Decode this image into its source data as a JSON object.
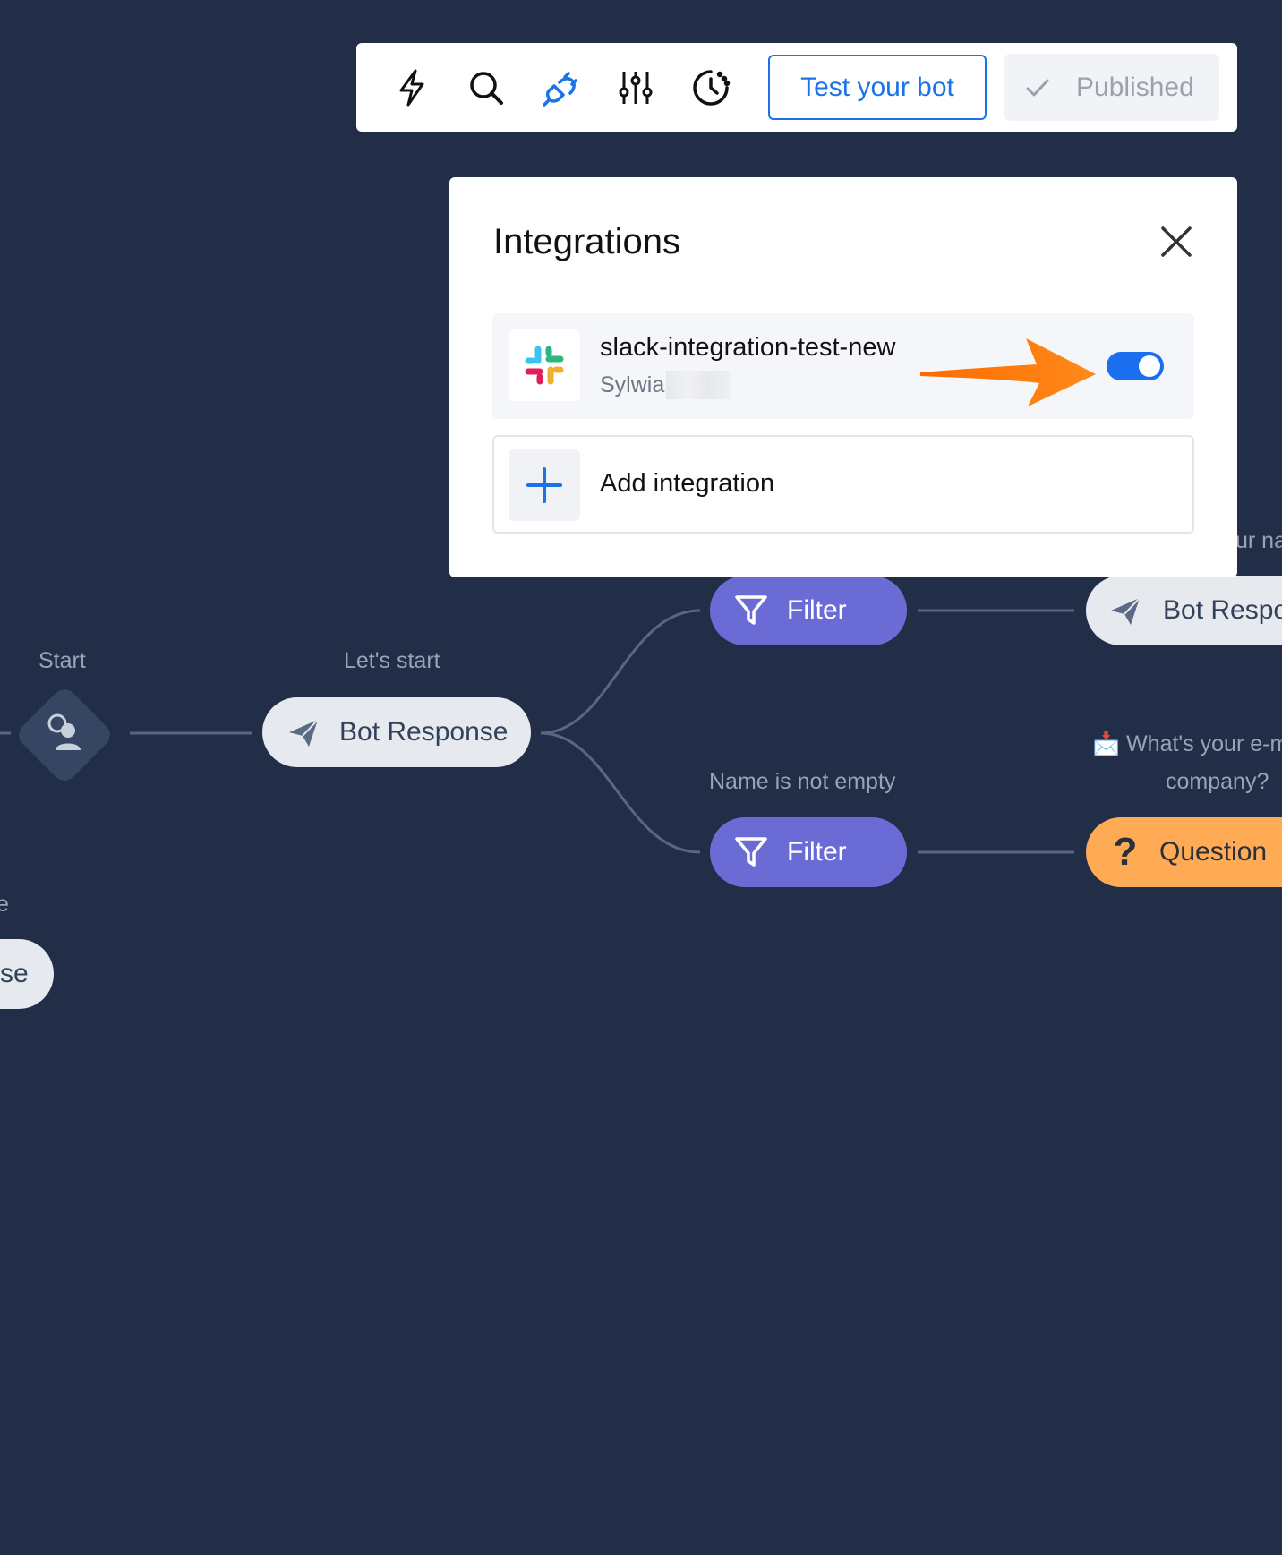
{
  "toolbar": {
    "icons": [
      "lightning-icon",
      "search-icon",
      "plug-icon",
      "sliders-icon",
      "history-icon"
    ],
    "active_icon_color": "#1a73e8",
    "test_button_label": "Test your bot",
    "published_label": "Published"
  },
  "integrations_panel": {
    "title": "Integrations",
    "items": [
      {
        "name": "slack-integration-test-new",
        "owner": "Sylwia",
        "enabled": true
      }
    ],
    "add_label": "Add integration"
  },
  "flow": {
    "start_label": "Start",
    "lets_start_label": "Let's start",
    "bot_response_label": "Bot Response",
    "filter_top_label": "Filter",
    "filter_bottom_label": "Filter",
    "filter_bottom_caption": "Name is not empty",
    "top_right_caption_fragment": "ur na",
    "top_right_node_label": "Bot Respo",
    "question_caption_line1": "📩 What's your e-m",
    "question_caption_line2": "company?",
    "question_node_label": "Question",
    "left_caption_fragment": "e",
    "left_node_fragment": "se",
    "colors": {
      "background": "#222e48",
      "filter": "#6b6bd6",
      "question": "#ffaa55",
      "bot_response": "#e6e9ee"
    }
  }
}
